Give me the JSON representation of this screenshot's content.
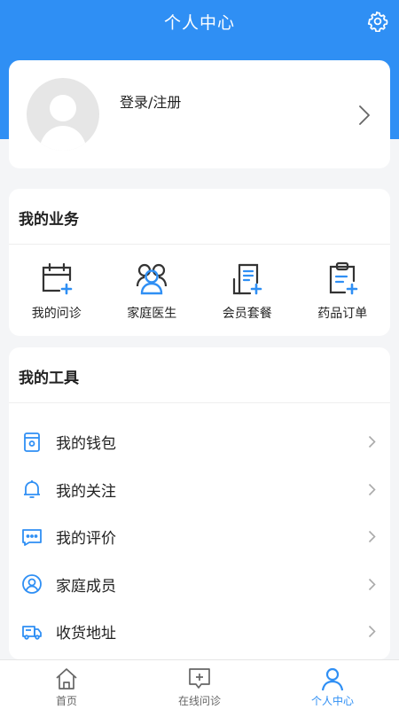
{
  "header": {
    "title": "个人中心"
  },
  "profile": {
    "login_label": "登录/注册"
  },
  "business": {
    "title": "我的业务",
    "items": [
      {
        "label": "我的问诊",
        "icon": "calendar-plus-icon"
      },
      {
        "label": "家庭医生",
        "icon": "family-doctor-icon"
      },
      {
        "label": "会员套餐",
        "icon": "member-package-icon"
      },
      {
        "label": "药品订单",
        "icon": "medicine-order-icon"
      }
    ]
  },
  "tools": {
    "title": "我的工具",
    "items": [
      {
        "label": "我的钱包",
        "icon": "wallet-icon"
      },
      {
        "label": "我的关注",
        "icon": "bell-icon"
      },
      {
        "label": "我的评价",
        "icon": "comment-icon"
      },
      {
        "label": "家庭成员",
        "icon": "user-circle-icon"
      },
      {
        "label": "收货地址",
        "icon": "truck-icon"
      }
    ]
  },
  "tabbar": {
    "items": [
      {
        "label": "首页",
        "icon": "home-icon"
      },
      {
        "label": "在线问诊",
        "icon": "online-consult-icon"
      },
      {
        "label": "个人中心",
        "icon": "person-icon",
        "active": true
      }
    ]
  },
  "colors": {
    "primary": "#2f8ff4",
    "icon_dark": "#333333",
    "icon_accent": "#2f8ff4"
  }
}
